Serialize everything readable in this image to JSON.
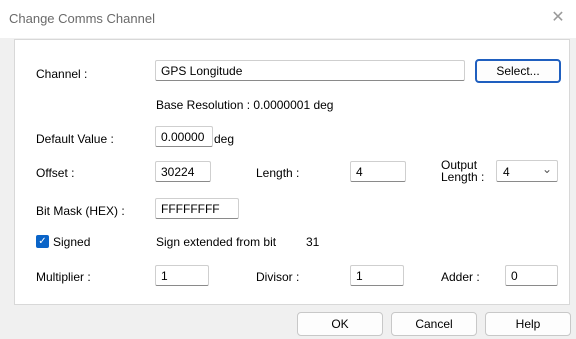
{
  "window": {
    "title": "Change Comms Channel",
    "close_glyph": "✕"
  },
  "form": {
    "channel_label": "Channel :",
    "channel_value": "GPS Longitude",
    "select_button": "Select...",
    "base_resolution": "Base Resolution :  0.0000001 deg",
    "default_value_label": "Default Value :",
    "default_value": "0.00000",
    "default_unit": "deg",
    "offset_label": "Offset :",
    "offset_value": "30224",
    "length_label": "Length :",
    "length_value": "4",
    "output_length_label_1": "Output",
    "output_length_label_2": "Length :",
    "output_length_value": "4",
    "bitmask_label": "Bit Mask (HEX) :",
    "bitmask_value": "FFFFFFFF",
    "signed_label": "Signed",
    "signed_checked": true,
    "sign_extended_text": "Sign extended from bit",
    "sign_extended_bit": "31",
    "multiplier_label": "Multiplier :",
    "multiplier_value": "1",
    "divisor_label": "Divisor :",
    "divisor_value": "1",
    "adder_label": "Adder :",
    "adder_value": "0"
  },
  "buttons": {
    "ok": "OK",
    "cancel": "Cancel",
    "help": "Help"
  },
  "colors": {
    "accent": "#0a64c8",
    "default_button_border": "#1f5fbf"
  }
}
